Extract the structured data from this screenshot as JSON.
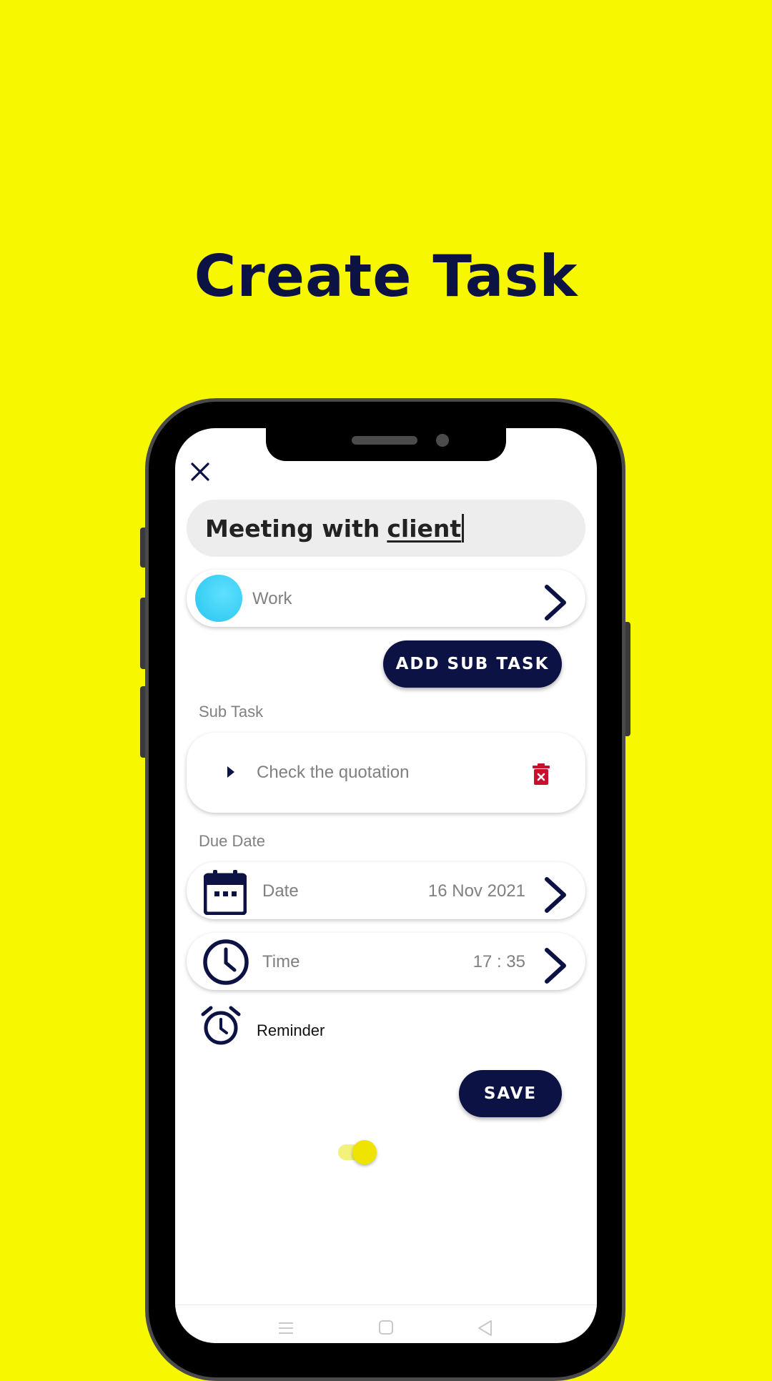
{
  "headline": "Create Task",
  "form": {
    "task_title_prefix": "Meeting with",
    "task_title_underlined": "client",
    "category": {
      "label": "Work",
      "color": "#3CD3F5"
    },
    "add_subtask_label": "ADD SUB TASK",
    "subtask_section_label": "Sub Task",
    "subtasks": [
      {
        "text": "Check the quotation"
      }
    ],
    "due_date_section_label": "Due Date",
    "date": {
      "label": "Date",
      "value": "16 Nov 2021"
    },
    "time": {
      "label": "Time",
      "value": "17 : 35"
    },
    "reminder": {
      "label": "Reminder",
      "enabled": true
    },
    "save_label": "SAVE"
  },
  "colors": {
    "background": "#F7F700",
    "navy": "#0D1244",
    "delete": "#C8102E",
    "toggle": "#EFE400"
  },
  "icons": {
    "close": "close-icon",
    "chevron": "chevron-right-icon",
    "expand": "caret-right-icon",
    "delete": "trash-icon",
    "calendar": "calendar-icon",
    "clock": "clock-icon",
    "alarm": "alarm-clock-icon"
  }
}
